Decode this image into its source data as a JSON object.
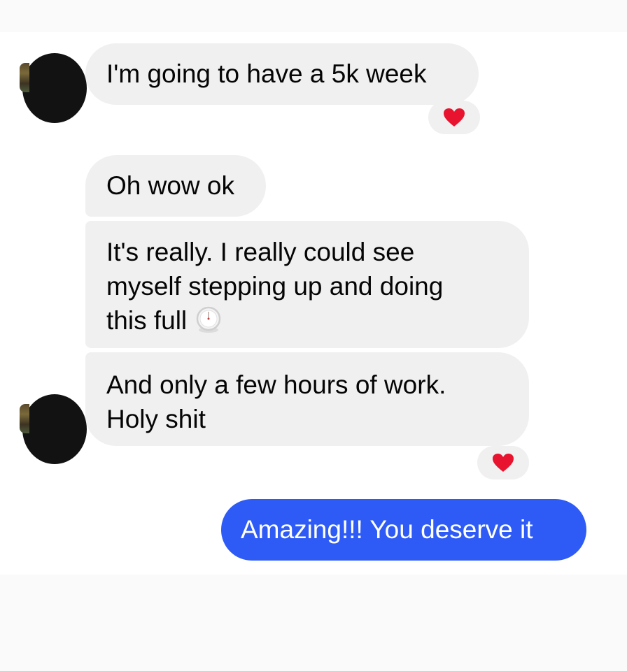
{
  "conversation": {
    "messages": [
      {
        "sender": "them",
        "text": "I'm going to have a 5k week",
        "reaction": "heart-icon"
      },
      {
        "sender": "them",
        "text": "Oh wow ok"
      },
      {
        "sender": "them",
        "lines": [
          "It's really. I really could see",
          "myself stepping up and doing",
          "this full"
        ],
        "trailing_emoji": "clock-icon"
      },
      {
        "sender": "them",
        "lines": [
          "And only a few hours of work.",
          "Holy shit"
        ],
        "reaction": "heart-icon"
      },
      {
        "sender": "me",
        "text": "Amazing!!! You deserve it"
      }
    ]
  },
  "colors": {
    "received_bubble": "#f0f0f0",
    "sent_bubble": "#2e5bf5",
    "heart": "#e8132f"
  }
}
